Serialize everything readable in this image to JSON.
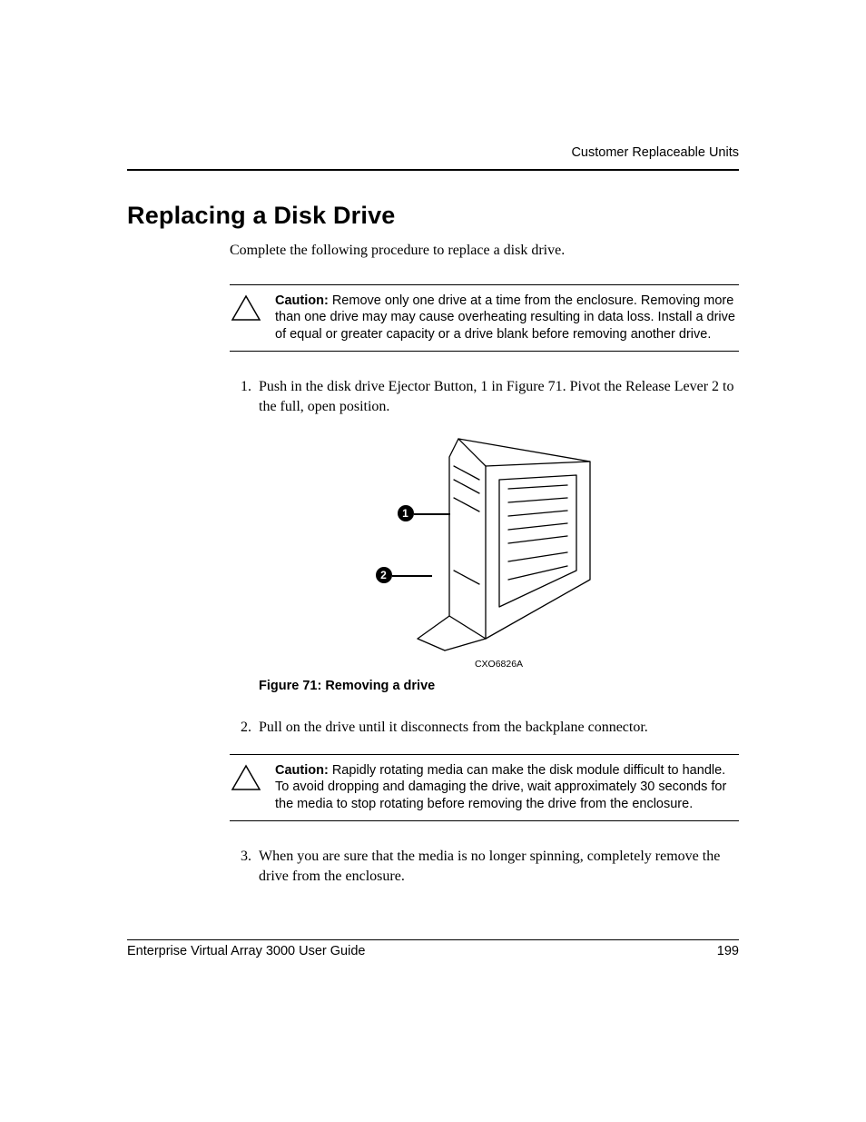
{
  "header": {
    "section": "Customer Replaceable Units"
  },
  "title": "Replacing a Disk Drive",
  "intro": "Complete the following procedure to replace a disk drive.",
  "caution1": {
    "label": "Caution:",
    "text": "Remove only one drive at a time from the enclosure. Removing more than one drive may may cause overheating resulting in data loss. Install a drive of equal or greater capacity or a drive blank before removing another drive."
  },
  "steps": {
    "s1": "Push in the disk drive Ejector Button, 1 in Figure 71. Pivot the Release Lever 2 to the full, open position.",
    "s2": "Pull on the drive until it disconnects from the backplane connector.",
    "s3": "When you are sure that the media is no longer spinning, completely remove the drive from the enclosure."
  },
  "figure": {
    "code": "CXO6826A",
    "caption": "Figure 71:  Removing a drive",
    "callouts": {
      "c1": "1",
      "c2": "2"
    }
  },
  "caution2": {
    "label": "Caution:",
    "text": "Rapidly rotating media can make the disk module difficult to handle. To avoid dropping and damaging the drive, wait approximately 30 seconds for the media to stop rotating before removing the drive from the enclosure."
  },
  "footer": {
    "guide": "Enterprise Virtual Array 3000 User Guide",
    "page": "199"
  }
}
